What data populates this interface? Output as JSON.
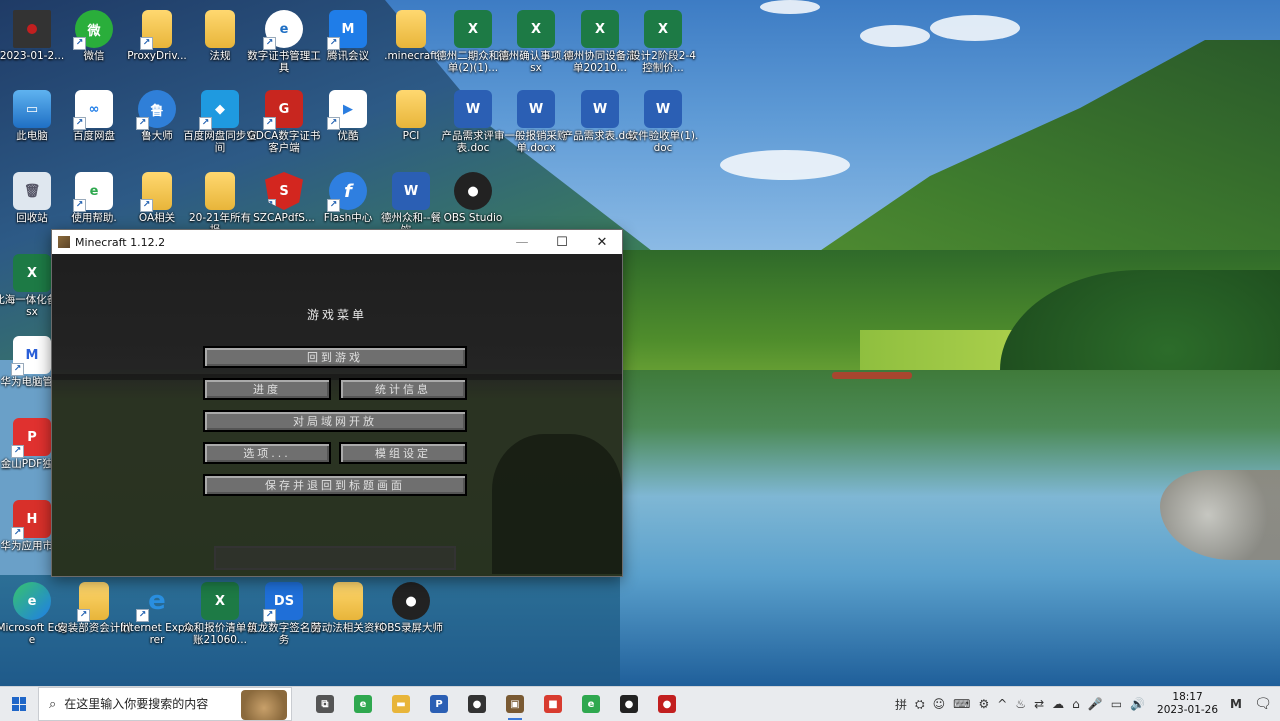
{
  "desktop": {
    "icons": [
      {
        "label": "2023-01-2...",
        "glyph": ""
      },
      {
        "label": "微信",
        "glyph": "微"
      },
      {
        "label": "ProxyDriv...",
        "glyph": ""
      },
      {
        "label": "法规",
        "glyph": ""
      },
      {
        "label": "数字证书管理工具",
        "glyph": "e"
      },
      {
        "label": "腾讯会议",
        "glyph": "M"
      },
      {
        "label": ".minecraft",
        "glyph": ""
      },
      {
        "label": "德州二期众和清单(2)(1)...",
        "glyph": "X"
      },
      {
        "label": "德州确认事项.xlsx",
        "glyph": "X"
      },
      {
        "label": "德州协同设备清单20210...",
        "glyph": "X"
      },
      {
        "label": "设计2阶段2-4控制价...",
        "glyph": "X"
      },
      {
        "label": "此电脑",
        "glyph": "▭"
      },
      {
        "label": "百度网盘",
        "glyph": "∞"
      },
      {
        "label": "鲁大师",
        "glyph": "鲁"
      },
      {
        "label": "百度网盘同步空间",
        "glyph": "◆"
      },
      {
        "label": "GDCA数字证书客户端",
        "glyph": "G"
      },
      {
        "label": "优酷",
        "glyph": "▶"
      },
      {
        "label": "PCI",
        "glyph": ""
      },
      {
        "label": "产品需求评审表.doc",
        "glyph": "W"
      },
      {
        "label": "一般报销采购单.docx",
        "glyph": "W"
      },
      {
        "label": "产品需求表.doc",
        "glyph": "W"
      },
      {
        "label": "软件验收单(1).doc",
        "glyph": "W"
      },
      {
        "label": "回收站",
        "glyph": "🗑"
      },
      {
        "label": "使用帮助.",
        "glyph": "e"
      },
      {
        "label": "OA相关",
        "glyph": ""
      },
      {
        "label": "20-21年所有报...",
        "glyph": ""
      },
      {
        "label": "SZCAPdfS...",
        "glyph": "S"
      },
      {
        "label": "Flash中心",
        "glyph": "f"
      },
      {
        "label": "德州众和--餐饮...",
        "glyph": "W"
      },
      {
        "label": "OBS Studio",
        "glyph": "●"
      },
      {
        "label": "北海一体化备.xlsx",
        "glyph": "X"
      },
      {
        "label": "华为电脑管家",
        "glyph": "M"
      },
      {
        "label": "金山PDF独版",
        "glyph": "P"
      },
      {
        "label": "华为应用市场",
        "glyph": "H"
      },
      {
        "label": "Microsoft Edge",
        "glyph": "e"
      },
      {
        "label": "安装部资会计划",
        "glyph": ""
      },
      {
        "label": "Internet Explorer",
        "glyph": "e"
      },
      {
        "label": "众和报价清单台账21060...",
        "glyph": "X"
      },
      {
        "label": "筑龙数字签名服务",
        "glyph": "DS"
      },
      {
        "label": "劳动法相关资料",
        "glyph": ""
      },
      {
        "label": "OBS录屏大师",
        "glyph": "●"
      }
    ]
  },
  "minecraft": {
    "window_title": "Minecraft 1.12.2",
    "menu_title": "游戏菜单",
    "buttons": {
      "back_to_game": "回到游戏",
      "advancements": "进度",
      "statistics": "统计信息",
      "open_to_lan": "对局域网开放",
      "options": "选项...",
      "mod_options": "模组设定",
      "save_and_quit": "保存并退回到标题画面"
    },
    "win_controls": {
      "minimize": "—",
      "maximize": "☐",
      "close": "✕"
    }
  },
  "taskbar": {
    "search_placeholder": "在这里输入你要搜索的内容",
    "apps": [
      {
        "name": "task-view",
        "glyph": "⧉",
        "color": "#555555"
      },
      {
        "name": "edge",
        "glyph": "e",
        "color": "#2fa84f"
      },
      {
        "name": "file-explorer",
        "glyph": "▬",
        "color": "#e8b53a"
      },
      {
        "name": "p-app",
        "glyph": "P",
        "color": "#2b5fb4"
      },
      {
        "name": "app-dark",
        "glyph": "●",
        "color": "#333333"
      },
      {
        "name": "minecraft",
        "glyph": "▣",
        "color": "#7a5a33"
      },
      {
        "name": "app-red",
        "glyph": "■",
        "color": "#d83b2f"
      },
      {
        "name": "edge-2",
        "glyph": "e",
        "color": "#2fa84f"
      },
      {
        "name": "obs",
        "glyph": "●",
        "color": "#222222"
      },
      {
        "name": "recorder",
        "glyph": "●",
        "color": "#c21f1f"
      }
    ],
    "tray_icons": [
      "拼",
      "⛭",
      "☺",
      "⌨",
      "⚙",
      "^",
      "♨",
      "⇄",
      "☁",
      "⌂",
      "🎤",
      "▭",
      "🔊"
    ],
    "clock_time": "18:17",
    "clock_date": "2023-01-26",
    "notification_icon": "🗨",
    "tray_badge": "M"
  }
}
